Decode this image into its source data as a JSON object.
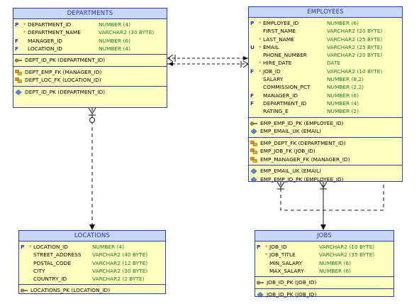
{
  "departments": {
    "title": "DEPARTMENTS",
    "columns": [
      {
        "flag": "P",
        "req": "*",
        "name": "DEPARTMENT_ID",
        "type": "NUMBER (4)"
      },
      {
        "flag": "",
        "req": "*",
        "name": "DEPARTMENT_NAME",
        "type": "VARCHAR2 (30 BYTE)"
      },
      {
        "flag": "F",
        "req": "",
        "name": "MANAGER_ID",
        "type": "NUMBER (6)"
      },
      {
        "flag": "F",
        "req": "",
        "name": "LOCATION_ID",
        "type": "NUMBER (4)"
      }
    ],
    "pk": [
      "DEPT_ID_PK (DEPARTMENT_ID)"
    ],
    "fks": [
      "DEPT_EMP_FK (MANAGER_ID)",
      "DEPT_LOC_FK (LOCATION_ID)"
    ],
    "indexes": [
      "DEPT_ID_PK (DEPARTMENT_ID)"
    ]
  },
  "employees": {
    "title": "EMPLOYEES",
    "columns": [
      {
        "flag": "P",
        "req": "*",
        "name": "EMPLOYEE_ID",
        "type": "NUMBER (6)"
      },
      {
        "flag": "",
        "req": "",
        "name": "FIRST_NAME",
        "type": "VARCHAR2 (20 BYTE)"
      },
      {
        "flag": "",
        "req": "*",
        "name": "LAST_NAME",
        "type": "VARCHAR2 (25 BYTE)"
      },
      {
        "flag": "U",
        "req": "*",
        "name": "EMAIL",
        "type": "VARCHAR2 (25 BYTE)"
      },
      {
        "flag": "",
        "req": "",
        "name": "PHONE_NUMBER",
        "type": "VARCHAR2 (20 BYTE)"
      },
      {
        "flag": "",
        "req": "*",
        "name": "HIRE_DATE",
        "type": "DATE"
      },
      {
        "flag": "F",
        "req": "*",
        "name": "JOB_ID",
        "type": "VARCHAR2 (10 BYTE)"
      },
      {
        "flag": "",
        "req": "",
        "name": "SALARY",
        "type": "NUMBER (8,2)"
      },
      {
        "flag": "",
        "req": "",
        "name": "COMMISSION_PCT",
        "type": "NUMBER (2,2)"
      },
      {
        "flag": "F",
        "req": "",
        "name": "MANAGER_ID",
        "type": "NUMBER (6)"
      },
      {
        "flag": "F",
        "req": "",
        "name": "DEPARTMENT_ID",
        "type": "NUMBER (4)"
      },
      {
        "flag": "",
        "req": "",
        "name": "RATING_E",
        "type": "NUMBER (2)"
      }
    ],
    "keys": [
      "EMP_EMP_ID_PK (EMPLOYEE_ID)",
      "EMP_EMAIL_UK (EMAIL)"
    ],
    "fks": [
      "EMP_DEPT_FK (DEPARTMENT_ID)",
      "EMP_JOB_FK (JOB_ID)",
      "EMP_MANAGER_FK (MANAGER_ID)"
    ],
    "indexes": [
      "EMP_EMAIL_UK (EMAIL)",
      "EMP_EMP_ID_PK (EMPLOYEE_ID)"
    ]
  },
  "locations": {
    "title": "LOCATIONS",
    "columns": [
      {
        "flag": "P",
        "req": "*",
        "name": "LOCATION_ID",
        "type": "NUMBER (4)"
      },
      {
        "flag": "",
        "req": "",
        "name": "STREET_ADDRESS",
        "type": "VARCHAR2 (40 BYTE)"
      },
      {
        "flag": "",
        "req": "",
        "name": "POSTAL_CODE",
        "type": "VARCHAR2 (12 BYTE)"
      },
      {
        "flag": "",
        "req": "",
        "name": "CITY",
        "type": "VARCHAR2 (30 BYTE)"
      },
      {
        "flag": "",
        "req": "",
        "name": "COUNTRY_ID",
        "type": "VARCHAR2 (2 BYTE)"
      }
    ],
    "pk": [
      "LOCATIONS_PK (LOCATION_ID)"
    ]
  },
  "jobs": {
    "title": "JOBS",
    "columns": [
      {
        "flag": "P",
        "req": "*",
        "name": "JOB_ID",
        "type": "VARCHAR2 (10 BYTE)"
      },
      {
        "flag": "",
        "req": "*",
        "name": "JOB_TITLE",
        "type": "VARCHAR2 (35 BYTE)"
      },
      {
        "flag": "",
        "req": "",
        "name": "MIN_SALARY",
        "type": "NUMBER (6)"
      },
      {
        "flag": "",
        "req": "",
        "name": "MAX_SALARY",
        "type": "NUMBER (6)"
      }
    ],
    "pk": [
      "JOB_ID_PK (JOB_ID)"
    ],
    "indexes": [
      "JOB_ID_PK (JOB_ID)"
    ]
  },
  "colors": {
    "header_bg": "#c9d7f6",
    "body_bg": "#ffffc0",
    "border": "#2a3fa8",
    "type_text": "#1a7a1a",
    "required_star": "#d23a1e"
  }
}
